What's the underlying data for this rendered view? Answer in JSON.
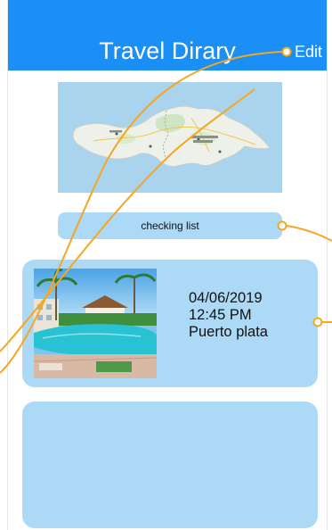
{
  "navbar": {
    "title": "Travel Dirary",
    "edit_label": "Edit"
  },
  "map": {
    "icon": "map-of-hispaniola"
  },
  "checking_list": {
    "label": "checking list"
  },
  "entries": [
    {
      "date": "04/06/2019",
      "time": "12:45 PM",
      "place": "Puerto plata",
      "photo_icon": "resort-pool-photo"
    }
  ],
  "colors": {
    "navbar": "#1a8ff5",
    "card": "#acd9f6",
    "connector": "#f5a623"
  }
}
